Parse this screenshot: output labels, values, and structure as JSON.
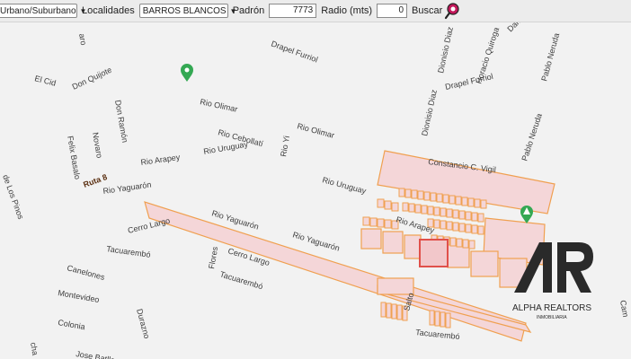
{
  "toolbar": {
    "zone_select": "Urbano/Suburbano",
    "localidades_label": "Localidades",
    "localidad_select": "BARROS BLANCOS",
    "padron_label": "Padrón",
    "padron_value": "7773",
    "radio_label": "Radio (mts)",
    "radio_value": "0",
    "buscar_label": "Buscar"
  },
  "map": {
    "streets": {
      "aro": "aro",
      "el_cid": "El Cid",
      "don_quijote": "Don Quijote",
      "don_ramon": "Don Ramón",
      "novaro": "Novaro",
      "felix_basalo": "Felix Basalo",
      "ruta8": "Ruta 8",
      "rio_yaguaron_1": "Rio Yaguarón",
      "rio_yaguaron_2": "Rio Yaguarón",
      "rio_yaguaron_3": "Rio Yaguarón",
      "cerro_largo_1": "Cerro Largo",
      "cerro_largo_2": "Cerro Largo",
      "tacuarembo_1": "Tacuarembó",
      "tacuarembo_2": "Tacuarembó",
      "tacuarembo_3": "Tacuarembó",
      "canelones": "Canelones",
      "montevideo": "Montevideo",
      "colonia": "Colonia",
      "jose_batlle": "Jose Batlle",
      "durazno": "Durazno",
      "flores": "Flores",
      "cha": "cha",
      "de_los_pinos": "de Los Pinos",
      "rio_olimar_1": "Rio Olimar",
      "rio_olimar_2": "Rio Olimar",
      "rio_cebollati": "Rio Cebollatí",
      "rio_yi": "Rio Yi",
      "rio_arapey_1": "Rio Arapey",
      "rio_arapey_2": "Rio Arapey",
      "rio_uruguay_1": "Rio Uruguay",
      "rio_uruguay_2": "Rio Uruguay",
      "drapel_furriol_1": "Drapel Furriol",
      "drapel_furriol_2": "Drapel Furriol",
      "dionisio_diaz_1": "Dionisio Diaz",
      "dionisio_diaz_2": "Dionisio Diaz",
      "horacio_quiroga": "Horacio Quiroga",
      "dario": "Dario",
      "pablo_neruda_1": "Pablo Neruda",
      "pablo_neruda_2": "Pablo Neruda",
      "constancio_vigil": "Constancio C. Vigil",
      "salto": "Salto",
      "cam": "Cam"
    },
    "parcel_fill": "#f4d6d8",
    "parcel_stroke": "#f0a050",
    "highlight_stroke": "#e0504a",
    "pin_color": "#34a853"
  },
  "watermark": {
    "brand": "ALPHA REALTORS",
    "sub": "INMOBILIARIA"
  }
}
